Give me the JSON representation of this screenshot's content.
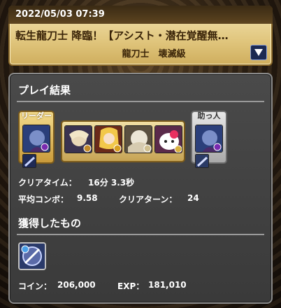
{
  "header": {
    "date": "2022/05/03 07:39",
    "title": "転生龍刀士 降臨！【アシスト・潜在覚醒無…",
    "subtitle": "龍刀士　壊滅級",
    "dropdown_icon": "triangle-down-icon"
  },
  "result": {
    "section_title": "プレイ結果",
    "leader_label": "リーダー",
    "helper_label": "助っ人",
    "clear_time_label": "クリアタイム：",
    "clear_time_value": "16分 3.3秒",
    "avg_combo_label": "平均コンボ：",
    "avg_combo_value": "9.58",
    "clear_turn_label": "クリアターン：",
    "clear_turn_value": "24"
  },
  "obtained": {
    "section_title": "獲得したもの",
    "coin_label": "コイン：",
    "coin_value": "206,000",
    "exp_label": "EXP：",
    "exp_value": "181,010"
  },
  "colors": {
    "panel": "#404040",
    "banner": "#e3c77e",
    "leader_frame": "#d9b558",
    "helper_frame": "#c4c4c4"
  }
}
